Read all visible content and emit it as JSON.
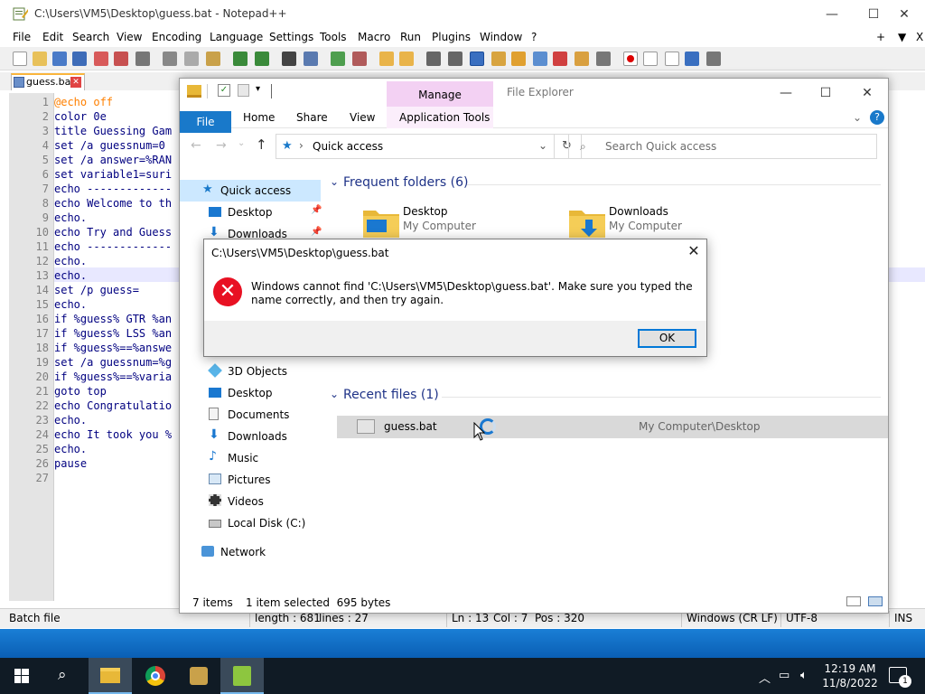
{
  "notepad": {
    "title": "C:\\Users\\VM5\\Desktop\\guess.bat - Notepad++",
    "menu": [
      "File",
      "Edit",
      "Search",
      "View",
      "Encoding",
      "Language",
      "Settings",
      "Tools",
      "Macro",
      "Run",
      "Plugins",
      "Window",
      "?"
    ],
    "menu_right": [
      "+",
      "▼",
      "X"
    ],
    "tab_label": "guess.bat",
    "lines": [
      {
        "n": "1",
        "text": "@echo off"
      },
      {
        "n": "2",
        "text": "color 0e"
      },
      {
        "n": "3",
        "text": "title Guessing Gam"
      },
      {
        "n": "4",
        "text": "set /a guessnum=0"
      },
      {
        "n": "5",
        "text": "set /a answer=%RAN"
      },
      {
        "n": "6",
        "text": "set variable1=suri"
      },
      {
        "n": "7",
        "text": "echo -------------"
      },
      {
        "n": "8",
        "text": "echo Welcome to th"
      },
      {
        "n": "9",
        "text": "echo."
      },
      {
        "n": "10",
        "text": "echo Try and Guess"
      },
      {
        "n": "11",
        "text": "echo -------------"
      },
      {
        "n": "12",
        "text": "echo."
      },
      {
        "n": "13",
        "text": "echo."
      },
      {
        "n": "14",
        "text": "set /p guess="
      },
      {
        "n": "15",
        "text": "echo."
      },
      {
        "n": "16",
        "text": "if %guess% GTR %an"
      },
      {
        "n": "17",
        "text": "if %guess% LSS %an"
      },
      {
        "n": "18",
        "text": "if %guess%==%answe"
      },
      {
        "n": "19",
        "text": "set /a guessnum=%g"
      },
      {
        "n": "20",
        "text": "if %guess%==%varia"
      },
      {
        "n": "21",
        "text": "goto top"
      },
      {
        "n": "22",
        "text": "echo Congratulatio"
      },
      {
        "n": "23",
        "text": "echo."
      },
      {
        "n": "24",
        "text": "echo It took you %"
      },
      {
        "n": "25",
        "text": "echo."
      },
      {
        "n": "26",
        "text": "pause"
      },
      {
        "n": "27",
        "text": ""
      }
    ],
    "status": {
      "type": "Batch file",
      "length": "length : 681",
      "lines": "lines : 27",
      "ln": "Ln : 13",
      "col": "Col : 7",
      "pos": "Pos : 320",
      "eol": "Windows (CR LF)",
      "encoding": "UTF-8",
      "mode": "INS"
    }
  },
  "explorer": {
    "title": "File Explorer",
    "manage": "Manage",
    "tabs": {
      "file": "File",
      "home": "Home",
      "share": "Share",
      "view": "View",
      "app_tools": "Application Tools"
    },
    "address": "Quick access",
    "search_placeholder": "Search Quick access",
    "nav": [
      {
        "label": "Quick access",
        "icon": "star-icon"
      },
      {
        "label": "Desktop",
        "icon": "desktop-icon"
      },
      {
        "label": "Downloads",
        "icon": "download-icon"
      },
      {
        "label": "3D Objects",
        "icon": "cube-icon"
      },
      {
        "label": "Desktop",
        "icon": "desktop-icon"
      },
      {
        "label": "Documents",
        "icon": "document-icon"
      },
      {
        "label": "Downloads",
        "icon": "download-icon"
      },
      {
        "label": "Music",
        "icon": "music-icon"
      },
      {
        "label": "Pictures",
        "icon": "pictures-icon"
      },
      {
        "label": "Videos",
        "icon": "video-icon"
      },
      {
        "label": "Local Disk (C:)",
        "icon": "disk-icon"
      },
      {
        "label": "Network",
        "icon": "network-icon"
      }
    ],
    "frequent_header": "Frequent folders (6)",
    "frequent": [
      {
        "name": "Desktop",
        "sub": "My Computer"
      },
      {
        "name": "Downloads",
        "sub": "My Computer"
      }
    ],
    "recent_header": "Recent files (1)",
    "recent": [
      {
        "name": "guess.bat",
        "location": "My Computer\\Desktop"
      }
    ],
    "status": {
      "items": "7 items",
      "selected": "1 item selected  695 bytes"
    }
  },
  "dialog": {
    "title": "C:\\Users\\VM5\\Desktop\\guess.bat",
    "message": "Windows cannot find 'C:\\Users\\VM5\\Desktop\\guess.bat'. Make sure you typed the name correctly, and then try again.",
    "ok": "OK",
    "close": "✕"
  },
  "taskbar": {
    "time": "12:19 AM",
    "date": "11/8/2022",
    "notifications": "1"
  },
  "colors": {
    "accent": "#0078d7",
    "error": "#e81123",
    "manage": "#f3d1f3",
    "selected": "#cce8ff"
  }
}
